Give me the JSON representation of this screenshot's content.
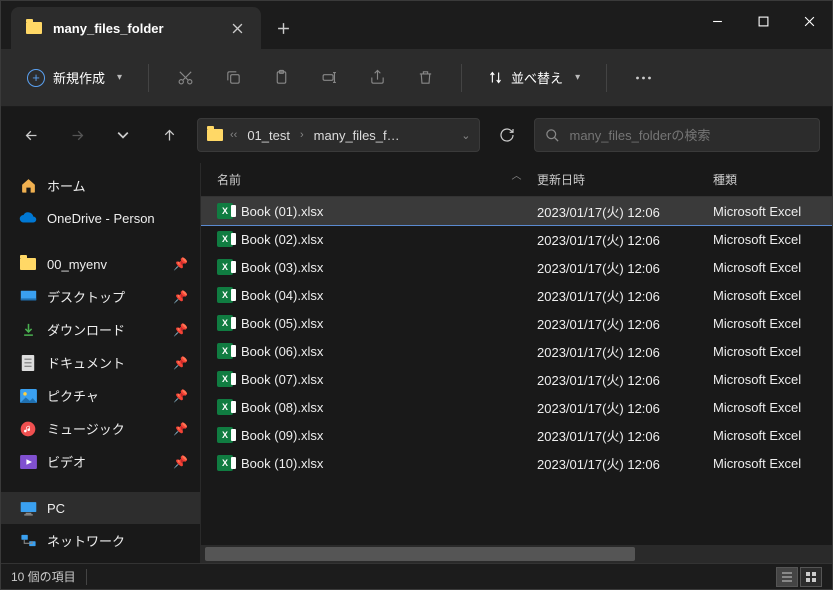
{
  "tab": {
    "title": "many_files_folder"
  },
  "toolbar": {
    "new_label": "新規作成",
    "sort_label": "並べ替え"
  },
  "breadcrumb": {
    "items": [
      "01_test",
      "many_files_f…"
    ]
  },
  "search": {
    "placeholder": "many_files_folderの検索"
  },
  "sidebar": {
    "items": [
      {
        "label": "ホーム",
        "icon": "home"
      },
      {
        "label": "OneDrive - Person",
        "icon": "onedrive"
      },
      {
        "sep": true
      },
      {
        "label": "00_myenv",
        "icon": "folder",
        "pinned": true
      },
      {
        "label": "デスクトップ",
        "icon": "desktop",
        "pinned": true
      },
      {
        "label": "ダウンロード",
        "icon": "download",
        "pinned": true
      },
      {
        "label": "ドキュメント",
        "icon": "document",
        "pinned": true
      },
      {
        "label": "ピクチャ",
        "icon": "pictures",
        "pinned": true
      },
      {
        "label": "ミュージック",
        "icon": "music",
        "pinned": true
      },
      {
        "label": "ビデオ",
        "icon": "video",
        "pinned": true
      },
      {
        "sep": true
      },
      {
        "label": "PC",
        "icon": "pc",
        "active": true
      },
      {
        "label": "ネットワーク",
        "icon": "network"
      }
    ]
  },
  "columns": {
    "name": "名前",
    "date": "更新日時",
    "type": "種類"
  },
  "files": [
    {
      "name": "Book (01).xlsx",
      "date": "2023/01/17(火) 12:06",
      "type": "Microsoft Excel",
      "selected": true
    },
    {
      "name": "Book (02).xlsx",
      "date": "2023/01/17(火) 12:06",
      "type": "Microsoft Excel"
    },
    {
      "name": "Book (03).xlsx",
      "date": "2023/01/17(火) 12:06",
      "type": "Microsoft Excel"
    },
    {
      "name": "Book (04).xlsx",
      "date": "2023/01/17(火) 12:06",
      "type": "Microsoft Excel"
    },
    {
      "name": "Book (05).xlsx",
      "date": "2023/01/17(火) 12:06",
      "type": "Microsoft Excel"
    },
    {
      "name": "Book (06).xlsx",
      "date": "2023/01/17(火) 12:06",
      "type": "Microsoft Excel"
    },
    {
      "name": "Book (07).xlsx",
      "date": "2023/01/17(火) 12:06",
      "type": "Microsoft Excel"
    },
    {
      "name": "Book (08).xlsx",
      "date": "2023/01/17(火) 12:06",
      "type": "Microsoft Excel"
    },
    {
      "name": "Book (09).xlsx",
      "date": "2023/01/17(火) 12:06",
      "type": "Microsoft Excel"
    },
    {
      "name": "Book (10).xlsx",
      "date": "2023/01/17(火) 12:06",
      "type": "Microsoft Excel"
    }
  ],
  "status": {
    "count_text": "10 個の項目"
  }
}
